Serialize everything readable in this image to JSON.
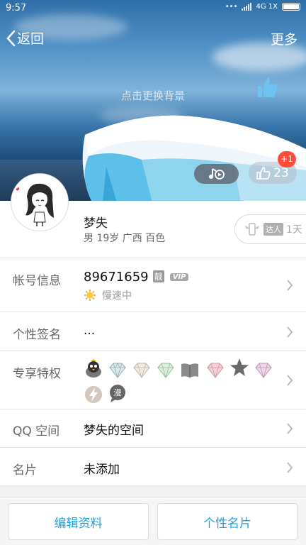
{
  "status_bar": {
    "time": "9:57",
    "network": "4G 1X"
  },
  "nav": {
    "back_label": "返回",
    "more_label": "更多"
  },
  "cover": {
    "hint": "点击更换背景"
  },
  "like": {
    "count": "23",
    "badge": "+1"
  },
  "profile": {
    "nickname": "梦失",
    "gender": "男",
    "age": "19岁",
    "province": "广西",
    "city": "百色",
    "daren_tag": "达人",
    "daren_days": "1天"
  },
  "rows": {
    "account": {
      "label": "帐号信息",
      "number": "89671659",
      "pretty_badge": "靓",
      "vip_badge": "VIP",
      "speed_text": "慢速中"
    },
    "signature": {
      "label": "个性签名",
      "value": "..."
    },
    "privileges": {
      "label": "专享特权"
    },
    "qzone": {
      "label": "QQ 空间",
      "value": "梦失的空间"
    },
    "card": {
      "label": "名片",
      "value": "未添加"
    }
  },
  "buttons": {
    "edit": "编辑资料",
    "card": "个性名片"
  },
  "colors": {
    "accent": "#1ba3e6",
    "badge_red": "#ff4d3a"
  }
}
